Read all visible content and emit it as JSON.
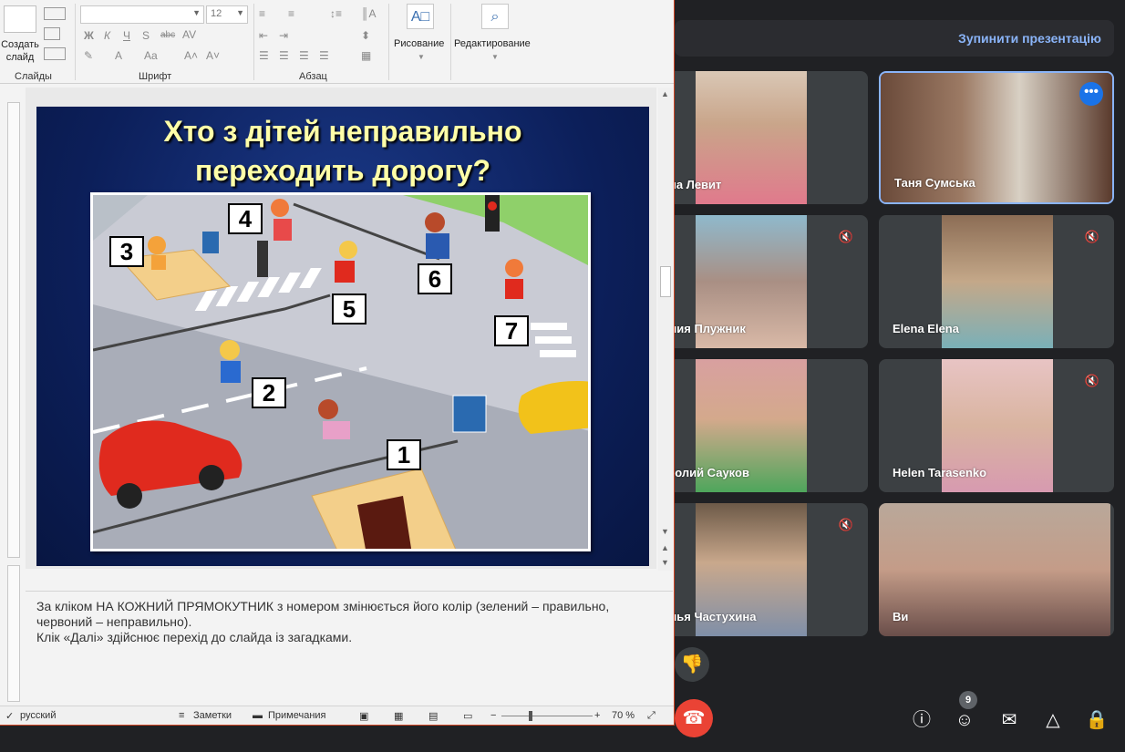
{
  "ribbon": {
    "create_slide": "Создать\nслайд",
    "create_slide_l1": "Создать",
    "create_slide_l2": "слайд",
    "font_size": "12",
    "group_slides": "Слайды",
    "group_font": "Шрифт",
    "group_paragraph": "Абзац",
    "drawing": "Рисование",
    "editing": "Редактирование",
    "bold": "Ж",
    "italic": "К",
    "underline": "Ч",
    "strike": "S",
    "abc": "abc",
    "av": "AV",
    "aa": "Aa"
  },
  "slide": {
    "title_line1": "Хто з дітей неправильно",
    "title_line2": "переходить дорогу?",
    "numbers": [
      "1",
      "2",
      "3",
      "4",
      "5",
      "6",
      "7"
    ]
  },
  "notes": {
    "line1": "За кліком НА КОЖНИЙ ПРЯМОКУТНИК з номером змінюється його колір (зелений – правильно,",
    "line2": "червоний – неправильно).",
    "line3": "Клік «Далі» здійснює перехід до слайда із загадками."
  },
  "status_bar": {
    "language": "русский",
    "notes_btn": "Заметки",
    "comments_btn": "Примечания",
    "zoom": "70 %"
  },
  "meet": {
    "stop_presentation": "Зупинити презентацію",
    "participant_count": "9",
    "participants": [
      {
        "name": "на Левит",
        "muted": false
      },
      {
        "name": "Таня Сумська",
        "muted": false
      },
      {
        "name": "лия Плужник",
        "muted": true
      },
      {
        "name": "Elena Elena",
        "muted": true
      },
      {
        "name": "толий Сауков",
        "muted": false
      },
      {
        "name": "Helen Tarasenko",
        "muted": true
      },
      {
        "name": "лья Частухина",
        "muted": true
      },
      {
        "name": "Ви",
        "muted": false
      }
    ]
  },
  "colors": {
    "accent": "#8ab4f8",
    "end_call": "#ea4335",
    "slide_title": "#ffffa8",
    "ppt_border": "#d24726"
  }
}
